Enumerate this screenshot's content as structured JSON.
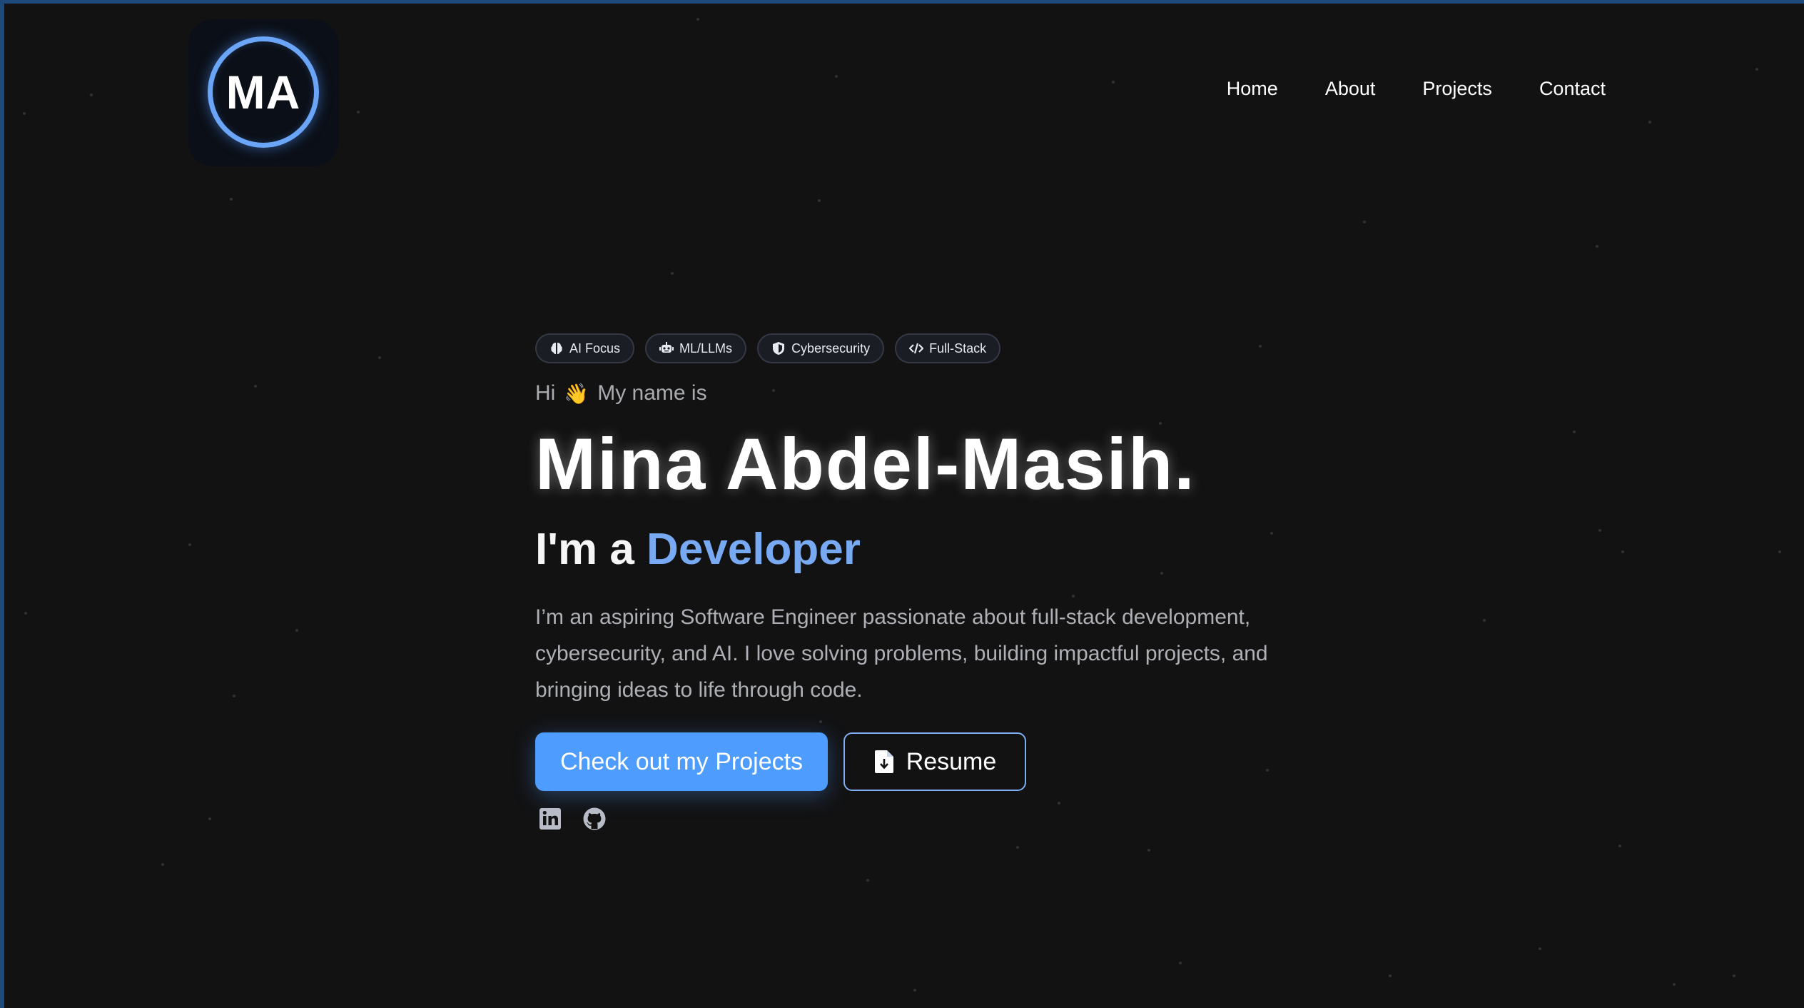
{
  "logo": {
    "text": "MA",
    "ring_color": "#6aa5f8"
  },
  "nav": {
    "items": [
      "Home",
      "About",
      "Projects",
      "Contact"
    ]
  },
  "hero": {
    "chips": [
      {
        "label": "AI Focus",
        "icon": "brain-icon"
      },
      {
        "label": "ML/LLMs",
        "icon": "robot-icon"
      },
      {
        "label": "Cybersecurity",
        "icon": "shield-icon"
      },
      {
        "label": "Full-Stack",
        "icon": "code-icon"
      }
    ],
    "greeting_hi": "Hi",
    "greeting_wave": "👋",
    "greeting_rest": "My name is",
    "name": "Mina Abdel-Masih.",
    "role_prefix": "I'm a",
    "role_highlight": "Developer",
    "bio": "I’m an aspiring Software Engineer passionate about full-stack development, cybersecurity, and AI. I love solving problems, building impactful projects, and bringing ideas to life through code.",
    "primary_button": "Check out my Projects",
    "secondary_button": "Resume",
    "socials": [
      "linkedin-icon",
      "github-icon"
    ]
  },
  "colors": {
    "background": "#121213",
    "accent": "#4f9cff",
    "highlight": "#78aaf4"
  }
}
